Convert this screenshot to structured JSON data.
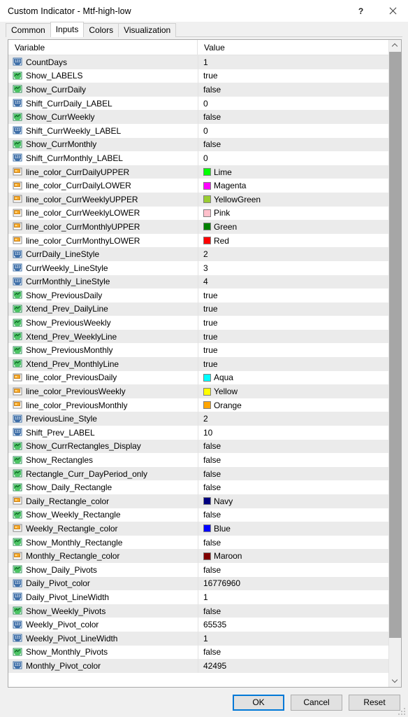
{
  "window": {
    "title": "Custom Indicator - Mtf-high-low",
    "help_button": "?",
    "close_button": "✕",
    "help_icon": "question-mark-icon",
    "close_icon": "close-icon"
  },
  "tabs": [
    {
      "label": "Common",
      "active": false
    },
    {
      "label": "Inputs",
      "active": true
    },
    {
      "label": "Colors",
      "active": false
    },
    {
      "label": "Visualization",
      "active": false
    }
  ],
  "table": {
    "columns": [
      "Variable",
      "Value"
    ],
    "rows": [
      {
        "icon": "number-input-icon",
        "variable": "CountDays",
        "value": "1",
        "type": "number"
      },
      {
        "icon": "boolean-input-icon",
        "variable": "Show_LABELS",
        "value": "true",
        "type": "bool"
      },
      {
        "icon": "boolean-input-icon",
        "variable": "Show_CurrDaily",
        "value": "false",
        "type": "bool"
      },
      {
        "icon": "number-input-icon",
        "variable": "Shift_CurrDaily_LABEL",
        "value": "0",
        "type": "number"
      },
      {
        "icon": "boolean-input-icon",
        "variable": "Show_CurrWeekly",
        "value": "false",
        "type": "bool"
      },
      {
        "icon": "number-input-icon",
        "variable": "Shift_CurrWeekly_LABEL",
        "value": "0",
        "type": "number"
      },
      {
        "icon": "boolean-input-icon",
        "variable": "Show_CurrMonthly",
        "value": "false",
        "type": "bool"
      },
      {
        "icon": "number-input-icon",
        "variable": "Shift_CurrMonthly_LABEL",
        "value": "0",
        "type": "number"
      },
      {
        "icon": "color-input-icon",
        "variable": "line_color_CurrDailyUPPER",
        "value": "Lime",
        "type": "color",
        "swatch": "#00ff00"
      },
      {
        "icon": "color-input-icon",
        "variable": "line_color_CurrDailyLOWER",
        "value": "Magenta",
        "type": "color",
        "swatch": "#ff00ff"
      },
      {
        "icon": "color-input-icon",
        "variable": "line_color_CurrWeeklyUPPER",
        "value": "YellowGreen",
        "type": "color",
        "swatch": "#9acd32"
      },
      {
        "icon": "color-input-icon",
        "variable": "line_color_CurrWeeklyLOWER",
        "value": "Pink",
        "type": "color",
        "swatch": "#ffc0cb"
      },
      {
        "icon": "color-input-icon",
        "variable": "line_color_CurrMonthlyUPPER",
        "value": "Green",
        "type": "color",
        "swatch": "#008000"
      },
      {
        "icon": "color-input-icon",
        "variable": "line_color_CurrMonthyLOWER",
        "value": "Red",
        "type": "color",
        "swatch": "#ff0000"
      },
      {
        "icon": "number-input-icon",
        "variable": "CurrDaily_LineStyle",
        "value": "2",
        "type": "number"
      },
      {
        "icon": "number-input-icon",
        "variable": "CurrWeekly_LineStyle",
        "value": "3",
        "type": "number"
      },
      {
        "icon": "number-input-icon",
        "variable": "CurrMonthly_LineStyle",
        "value": "4",
        "type": "number"
      },
      {
        "icon": "boolean-input-icon",
        "variable": "Show_PreviousDaily",
        "value": "true",
        "type": "bool"
      },
      {
        "icon": "boolean-input-icon",
        "variable": "Xtend_Prev_DailyLine",
        "value": "true",
        "type": "bool"
      },
      {
        "icon": "boolean-input-icon",
        "variable": "Show_PreviousWeekly",
        "value": "true",
        "type": "bool"
      },
      {
        "icon": "boolean-input-icon",
        "variable": "Xtend_Prev_WeeklyLine",
        "value": "true",
        "type": "bool"
      },
      {
        "icon": "boolean-input-icon",
        "variable": "Show_PreviousMonthly",
        "value": "true",
        "type": "bool"
      },
      {
        "icon": "boolean-input-icon",
        "variable": "Xtend_Prev_MonthlyLine",
        "value": "true",
        "type": "bool"
      },
      {
        "icon": "color-input-icon",
        "variable": "line_color_PreviousDaily",
        "value": "Aqua",
        "type": "color",
        "swatch": "#00ffff"
      },
      {
        "icon": "color-input-icon",
        "variable": "line_color_PreviousWeekly",
        "value": "Yellow",
        "type": "color",
        "swatch": "#ffff00"
      },
      {
        "icon": "color-input-icon",
        "variable": "line_color_PreviousMonthly",
        "value": "Orange",
        "type": "color",
        "swatch": "#ffa500"
      },
      {
        "icon": "number-input-icon",
        "variable": "PreviousLine_Style",
        "value": "2",
        "type": "number"
      },
      {
        "icon": "number-input-icon",
        "variable": "Shift_Prev_LABEL",
        "value": "10",
        "type": "number"
      },
      {
        "icon": "boolean-input-icon",
        "variable": "Show_CurrRectangles_Display",
        "value": "false",
        "type": "bool"
      },
      {
        "icon": "boolean-input-icon",
        "variable": "Show_Rectangles",
        "value": "false",
        "type": "bool"
      },
      {
        "icon": "boolean-input-icon",
        "variable": "Rectangle_Curr_DayPeriod_only",
        "value": "false",
        "type": "bool"
      },
      {
        "icon": "boolean-input-icon",
        "variable": "Show_Daily_Rectangle",
        "value": "false",
        "type": "bool"
      },
      {
        "icon": "color-input-icon",
        "variable": "Daily_Rectangle_color",
        "value": "Navy",
        "type": "color",
        "swatch": "#000080"
      },
      {
        "icon": "boolean-input-icon",
        "variable": "Show_Weekly_Rectangle",
        "value": "false",
        "type": "bool"
      },
      {
        "icon": "color-input-icon",
        "variable": "Weekly_Rectangle_color",
        "value": "Blue",
        "type": "color",
        "swatch": "#0000ff"
      },
      {
        "icon": "boolean-input-icon",
        "variable": "Show_Monthly_Rectangle",
        "value": "false",
        "type": "bool"
      },
      {
        "icon": "color-input-icon",
        "variable": "Monthly_Rectangle_color",
        "value": "Maroon",
        "type": "color",
        "swatch": "#800000"
      },
      {
        "icon": "boolean-input-icon",
        "variable": "Show_Daily_Pivots",
        "value": "false",
        "type": "bool"
      },
      {
        "icon": "number-input-icon",
        "variable": "Daily_Pivot_color",
        "value": "16776960",
        "type": "number"
      },
      {
        "icon": "number-input-icon",
        "variable": "Daily_Pivot_LineWidth",
        "value": "1",
        "type": "number"
      },
      {
        "icon": "boolean-input-icon",
        "variable": "Show_Weekly_Pivots",
        "value": "false",
        "type": "bool"
      },
      {
        "icon": "number-input-icon",
        "variable": "Weekly_Pivot_color",
        "value": "65535",
        "type": "number"
      },
      {
        "icon": "number-input-icon",
        "variable": "Weekly_Pivot_LineWidth",
        "value": "1",
        "type": "number"
      },
      {
        "icon": "boolean-input-icon",
        "variable": "Show_Monthly_Pivots",
        "value": "false",
        "type": "bool"
      },
      {
        "icon": "number-input-icon",
        "variable": "Monthly_Pivot_color",
        "value": "42495",
        "type": "number"
      }
    ]
  },
  "scrollbar": {
    "up_icon": "chevron-up-icon",
    "down_icon": "chevron-down-icon",
    "thumb_top_pct": 0,
    "thumb_height_pct": 94
  },
  "footer": {
    "ok": "OK",
    "cancel": "Cancel",
    "reset": "Reset"
  },
  "colors": {
    "accent": "#0078d7",
    "row_alt": "#ebebeb",
    "dialog_bg": "#f0f0f0",
    "border": "#a9a9a9"
  }
}
